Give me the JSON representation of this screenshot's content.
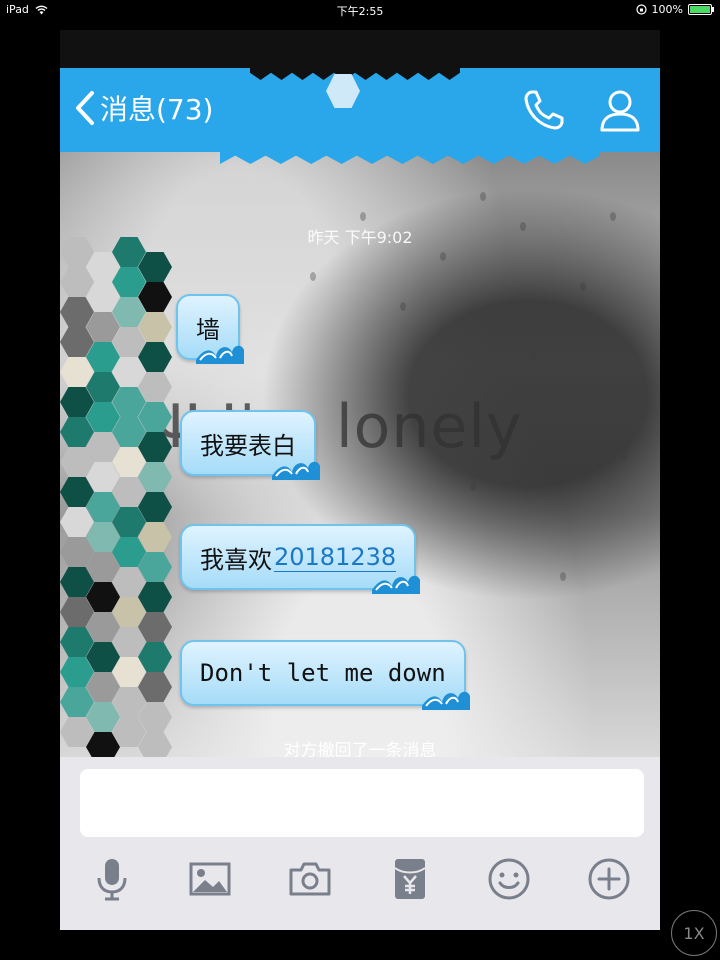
{
  "status_bar": {
    "device": "iPad",
    "time": "下午2:55",
    "battery_percent": "100%",
    "battery_level": 1.0
  },
  "nav": {
    "back_label": "消息(73)",
    "phone_icon": "phone-icon",
    "profile_icon": "profile-icon"
  },
  "chat": {
    "timestamp": "昨天 下午9:02",
    "background_text": "Ψ I'm lonely",
    "messages": [
      {
        "text": "墙"
      },
      {
        "text": "我要表白"
      },
      {
        "text_prefix": "我喜欢",
        "link": "20181238"
      },
      {
        "text": "Don't let me down"
      }
    ],
    "recall_notice": "对方撤回了一条消息"
  },
  "input": {
    "value": "",
    "tools": [
      "mic-icon",
      "image-icon",
      "camera-icon",
      "red-packet-icon",
      "emoji-icon",
      "plus-icon"
    ]
  },
  "zoom_label": "1X",
  "colors": {
    "nav": "#2aa6ea",
    "bubble": "#a6dcf8",
    "input_bg": "#e8e8ec",
    "icon": "#7a7f8c"
  }
}
